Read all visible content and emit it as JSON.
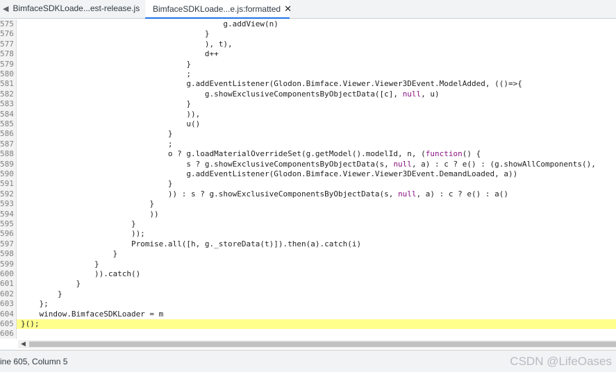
{
  "tabs": [
    {
      "label": "BimfaceSDKLoade...est-release.js"
    },
    {
      "label": "BimfaceSDKLoade...e.js:formatted"
    }
  ],
  "editor": {
    "lines": [
      {
        "num": "575",
        "text": "                                            g.addView(n)"
      },
      {
        "num": "576",
        "text": "                                        }"
      },
      {
        "num": "577",
        "text": "                                        ), t),"
      },
      {
        "num": "578",
        "text": "                                        d++"
      },
      {
        "num": "579",
        "text": "                                    }"
      },
      {
        "num": "580",
        "text": "                                    ;"
      },
      {
        "num": "581",
        "text": "                                    g.addEventListener(Glodon.Bimface.Viewer.Viewer3DEvent.ModelAdded, (()=>{"
      },
      {
        "num": "582",
        "text": "                                        g.showExclusiveComponentsByObjectData([c], null, u)"
      },
      {
        "num": "583",
        "text": "                                    }"
      },
      {
        "num": "584",
        "text": "                                    )),"
      },
      {
        "num": "585",
        "text": "                                    u()"
      },
      {
        "num": "586",
        "text": "                                }"
      },
      {
        "num": "587",
        "text": "                                ;"
      },
      {
        "num": "588",
        "text": "                                o ? g.loadMaterialOverrideSet(g.getModel().modelId, n, (function() {"
      },
      {
        "num": "589",
        "text": "                                    s ? g.showExclusiveComponentsByObjectData(s, null, a) : c ? e() : (g.showAllComponents(),"
      },
      {
        "num": "590",
        "text": "                                    g.addEventListener(Glodon.Bimface.Viewer.Viewer3DEvent.DemandLoaded, a))"
      },
      {
        "num": "591",
        "text": "                                }"
      },
      {
        "num": "592",
        "text": "                                )) : s ? g.showExclusiveComponentsByObjectData(s, null, a) : c ? e() : a()"
      },
      {
        "num": "593",
        "text": "                            }"
      },
      {
        "num": "594",
        "text": "                            ))"
      },
      {
        "num": "595",
        "text": "                        }"
      },
      {
        "num": "596",
        "text": "                        ));"
      },
      {
        "num": "597",
        "text": "                        Promise.all([h, g._storeData(t)]).then(a).catch(i)"
      },
      {
        "num": "598",
        "text": "                    }"
      },
      {
        "num": "599",
        "text": "                }"
      },
      {
        "num": "600",
        "text": "                )).catch()"
      },
      {
        "num": "601",
        "text": "            }"
      },
      {
        "num": "602",
        "text": "        }"
      },
      {
        "num": "603",
        "text": "    };"
      },
      {
        "num": "604",
        "text": "    window.BimfaceSDKLoader = m"
      },
      {
        "num": "605",
        "text": "}();"
      },
      {
        "num": "606",
        "text": ""
      }
    ],
    "highlighted_line": "605",
    "highlight_color": "#ffff8c"
  },
  "status": {
    "position": "ine 605, Column 5"
  },
  "watermark": "CSDN @LifeOases",
  "colors": {
    "accent": "#1a73e8",
    "keyword": "#881280",
    "number": "#1c00cf"
  },
  "icons": {
    "tab_back": "left-arrow-icon",
    "tab_close": "close-icon",
    "scroll_left": "scroll-left-arrow-icon"
  }
}
